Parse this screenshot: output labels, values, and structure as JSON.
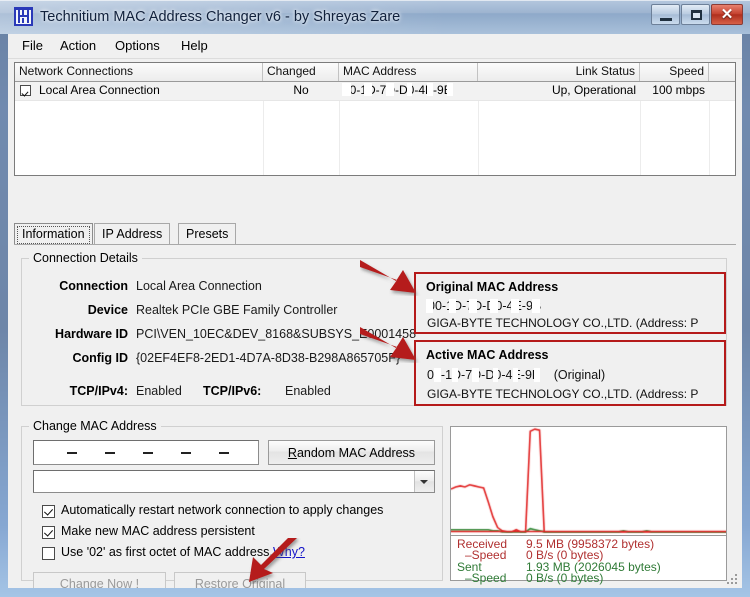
{
  "window": {
    "title": "Technitium MAC Address Changer v6 - by Shreyas Zare",
    "app_icon": "technitium-logo-icon",
    "minimize_label": "–",
    "maximize_label": "□",
    "close_label": "✕"
  },
  "menu": [
    {
      "label": "File"
    },
    {
      "label": "Action"
    },
    {
      "label": "Options"
    },
    {
      "label": "Help"
    }
  ],
  "list": {
    "columns": [
      {
        "label": "Network Connections",
        "align": "left"
      },
      {
        "label": "Changed",
        "align": "left"
      },
      {
        "label": "MAC Address",
        "align": "left"
      },
      {
        "label": "Link Status",
        "align": "right"
      },
      {
        "label": "Speed",
        "align": "right"
      }
    ],
    "rows": [
      {
        "checked": true,
        "name": "Local Area Connection",
        "changed": "No",
        "mac": "00-1D-7D-D0-4E-9B",
        "mac_redacted": true,
        "link_status": "Up, Operational",
        "speed": "100 mbps"
      }
    ]
  },
  "tabs": [
    {
      "label": "Information",
      "selected": true
    },
    {
      "label": "IP Address",
      "selected": false
    },
    {
      "label": "Presets",
      "selected": false
    }
  ],
  "connection_details": {
    "group_label": "Connection Details",
    "fields": [
      {
        "label": "Connection",
        "value": "Local Area Connection"
      },
      {
        "label": "Device",
        "value": "Realtek PCIe GBE Family Controller"
      },
      {
        "label": "Hardware ID",
        "value": "PCI\\VEN_10EC&DEV_8168&SUBSYS_E0001458"
      },
      {
        "label": "Config ID",
        "value": "{02EF4EF8-2ED1-4D7A-8D38-B298A865705F}"
      }
    ],
    "tcp_ipv4_label": "TCP/IPv4:",
    "tcp_ipv4_value": "Enabled",
    "tcp_ipv6_label": "TCP/IPv6:",
    "tcp_ipv6_value": "Enabled"
  },
  "original_mac": {
    "title": "Original MAC Address",
    "address": "00-1D-7D-D0-4E-9B",
    "vendor": "GIGA-BYTE TECHNOLOGY CO.,LTD.  (Address: P"
  },
  "active_mac": {
    "title": "Active MAC Address",
    "address": "00-1D-7D-D0-4E-9B",
    "suffix": "(Original)",
    "vendor": "GIGA-BYTE TECHNOLOGY CO.,LTD.  (Address: P"
  },
  "change_mac": {
    "group_label": "Change MAC Address",
    "mac_input_value": "",
    "mac_separator": "–",
    "preset_value": "",
    "random_button": "Random MAC Address",
    "random_button_accesskey": "R",
    "checkboxes": [
      {
        "label": "Automatically restart network connection to apply changes",
        "checked": true
      },
      {
        "label": "Make new MAC address persistent",
        "checked": true
      },
      {
        "label": "Use '02' as first octet of MAC address.",
        "checked": false
      }
    ],
    "why_link": "Why?",
    "change_now_button": "Change Now !",
    "change_now_accesskey": "C",
    "restore_button": "Restore Original",
    "restore_accesskey": "O"
  },
  "stats": {
    "received_label": "Received",
    "received_value": "9.5 MB (9958372 bytes)",
    "received_speed_label": "–Speed",
    "received_speed_value": "0 B/s (0 bytes)",
    "sent_label": "Sent",
    "sent_value": "1.93 MB (2026045 bytes)",
    "sent_speed_label": "–Speed",
    "sent_speed_value": "0 B/s (0 bytes)",
    "received_color": "#b03030",
    "sent_color": "#2f7a36"
  },
  "chart_data": {
    "type": "line",
    "title": "",
    "xlabel": "",
    "ylabel": "",
    "grid": false,
    "legend": "none",
    "series": [
      {
        "name": "Received",
        "color": "#e02020",
        "values": [
          42,
          44,
          45,
          44,
          46,
          45,
          44,
          43,
          30,
          16,
          6,
          3,
          2,
          2,
          4,
          2,
          2,
          96,
          98,
          97,
          2,
          2,
          2,
          2,
          2,
          2,
          2,
          2,
          2,
          2,
          2,
          2,
          2,
          2,
          2,
          2,
          2,
          2,
          2,
          2,
          2,
          2,
          2,
          2,
          2,
          2,
          2,
          2,
          2,
          2,
          2,
          2,
          2,
          2,
          2,
          2,
          2,
          2,
          2,
          2
        ]
      },
      {
        "name": "Sent",
        "color": "#2f8a36",
        "values": [
          4,
          4,
          4,
          4,
          4,
          4,
          4,
          4,
          4,
          3,
          3,
          2,
          2,
          2,
          2,
          2,
          2,
          5,
          4,
          3,
          2,
          2,
          2,
          2,
          2,
          2,
          2,
          2,
          2,
          2,
          2,
          2,
          2,
          2,
          2,
          2,
          2,
          3,
          2,
          2,
          2,
          2,
          3,
          2,
          2,
          2,
          2,
          2,
          2,
          2,
          2,
          2,
          2,
          2,
          2,
          2,
          2,
          2,
          2,
          2
        ]
      }
    ],
    "ylim": [
      0,
      100
    ],
    "x": [
      0,
      60
    ]
  },
  "annotations": {
    "arrow_to_original_mac": "red-arrow-icon",
    "arrow_to_active_mac": "red-arrow-icon",
    "arrow_to_restore_button": "red-arrow-icon"
  }
}
